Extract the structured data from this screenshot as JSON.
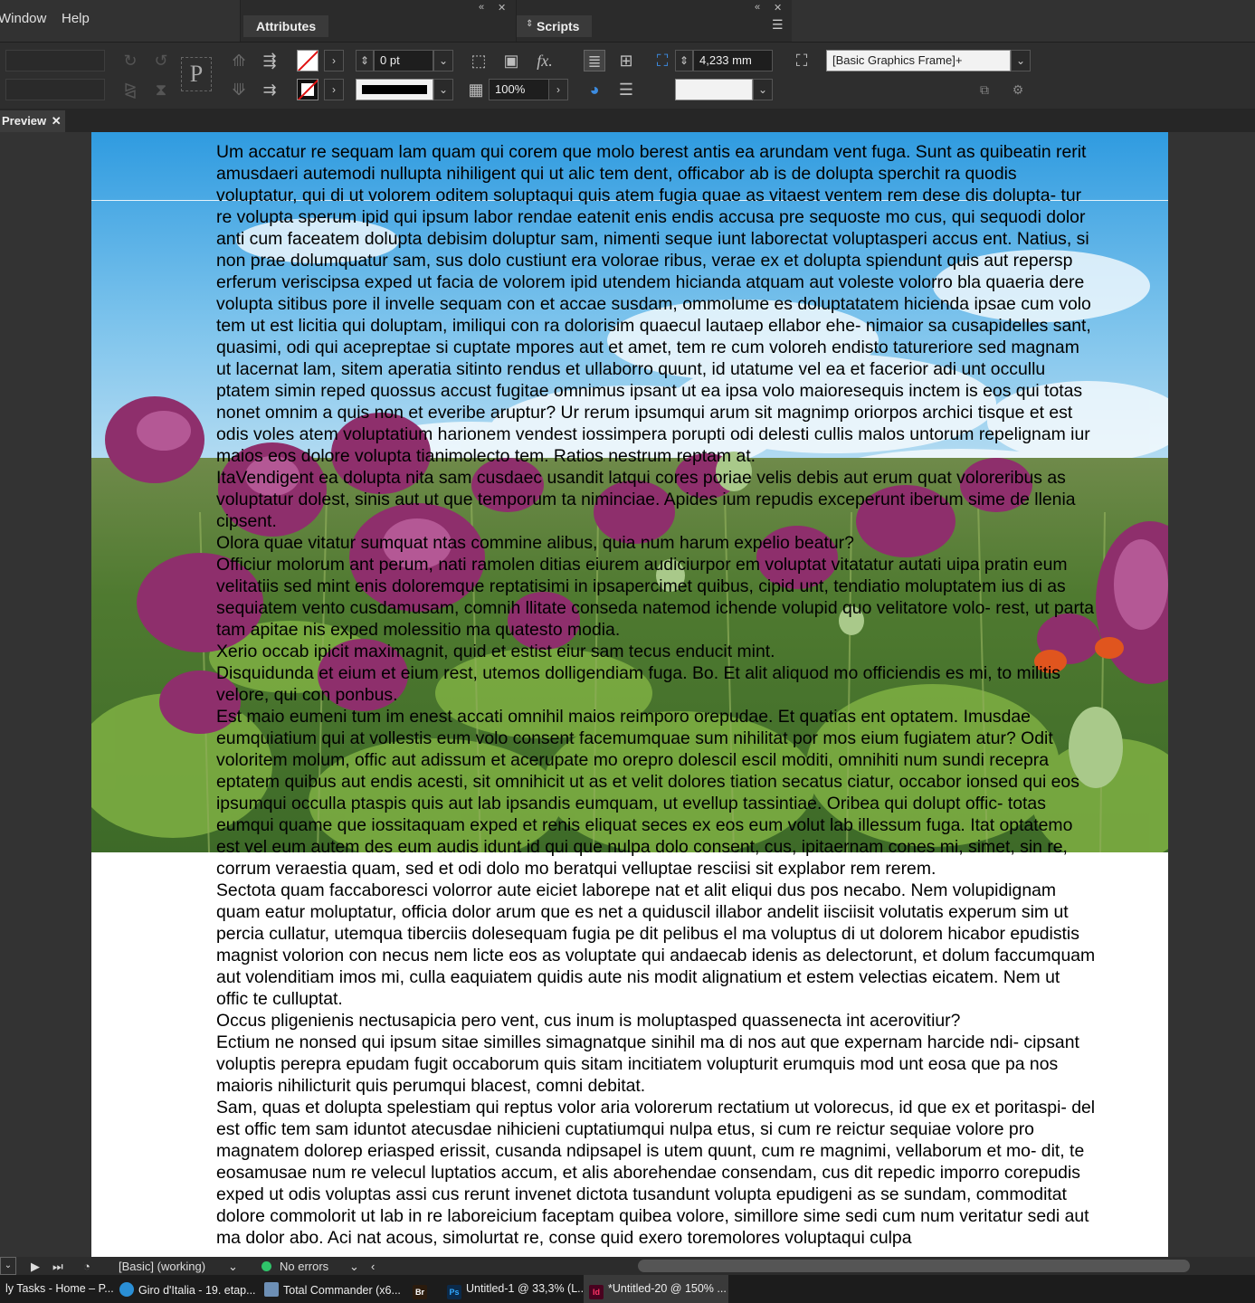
{
  "menu": {
    "items": [
      "Window",
      "Help"
    ]
  },
  "panels": {
    "attributes_tab": "Attributes",
    "scripts_tab": "Scripts",
    "collapse_glyph": "«",
    "close_glyph": "✕"
  },
  "control_bar": {
    "stroke_weight": "0 pt",
    "opacity": "100%",
    "offset": "4,233 mm",
    "object_style": "[Basic Graphics Frame]+",
    "fx_label": "fx."
  },
  "document_tab": {
    "label": "Preview",
    "close_glyph": "✕"
  },
  "page": {
    "paragraphs": [
      "Um accatur re sequam lam quam qui corem que molo berest antis ea arundam vent fuga. Sunt as quibeatin rerit amusdaeri autemodi nullupta nihiligent qui ut alic tem dent, officabor ab is de dolupta sperchit ra quodis voluptatur, qui di ut volorem oditem soluptaqui quis atem fugia quae as vitaest ventem rem dese dis dolupta- tur re volupta sperum ipid qui ipsum labor rendae eatenit enis endis accusa pre sequoste mo cus, qui sequodi dolor anti cum faceatem dolupta debisim doluptur sam, nimenti seque iunt laborectat voluptasperi accus ent. Natius, si non prae dolumquatur sam, sus dolo custiunt era volorae ribus, verae ex et dolupta spiendunt quis aut repersp erferum veriscipsa exped ut facia de volorem ipid utendem hicianda atquam aut voleste volorro bla quaeria dere volupta sitibus pore il invelle sequam con et accae susdam, ommolume es doluptatatem hicienda ipsae cum volo tem ut est licitia qui doluptam, imiliqui con ra dolorisim quaecul lautaep ellabor ehe- nimaior sa cusapidelles sant, quasimi, odi qui acepreptae si cuptate mpores aut et amet, tem re cum voloreh endisto tatureriore sed magnam ut lacernat lam, sitem aperatia sitinto rendus et ullaborro quunt, id utatume vel ea et facerior adi unt occullu ptatem simin reped quossus accust fugitae omnimus ipsant ut ea ipsa volo maioresequis inctem is eos qui totas nonet omnim a quis non et everibe aruptur? Ur rerum ipsumqui arum sit magnimp oriorpos archici tisque et est odis voles atem voluptatium harionem vendest iossimpera porupti odi delesti cullis malos untorum repelignam iur maios eos dolore volupta tianimolecto tem. Ratios nestrum reptam at.",
      "ItaVendigent ea dolupta nita sam cusdaec usandit latqui cores poriae velis debis aut erum quat voloreribus as voluptatur dolest, sinis aut ut que temporum ta niminciae. Apides ium repudis exceperunt iberum sime de llenia cipsent.",
      "Olora quae vitatur sumquat ntas commine alibus, quia num harum expelio beatur?",
      "Officiur molorum ant perum, nati ramolen ditias eiurem audiciurpor em voluptat vitatatur autati uipa pratin eum velitatiis sed mint enis doloremque reptatisimi in ipsapercimet quibus, cipid unt, tendiatio moluptatem ius di as sequiatem vento cusdamusam, comnih llitate conseda natemod ichende volupid quo velitatore volo- rest, ut parta tam apitae nis exped molessitio ma quatesto modia.",
      "Xerio occab ipicit maximagnit, quid et estist eiur sam tecus enducit mint.",
      "Disquidunda et eium et eium rest, utemos dolligendiam fuga. Bo. Et alit aliquod mo officiendis es mi, to militis velore, qui con ponbus.",
      "Est maio eumeni tum im enest accati omnihil maios reimporo orepudae. Et quatias ent optatem. Imusdae eumquiatium qui at vollestis eum volo consent facemumquae sum nihilitat por mos eium fugiatem atur? Odit voloritem molum, offic aut adissum et acerupate mo orepro dolescil escil moditi, omnihiti num sundi recepra eptatem quibus aut endis acesti, sit omnihicit ut as et velit dolores tiation secatus ciatur, occabor ionsed qui eos ipsumqui occulla ptaspis quis aut lab ipsandis eumquam, ut evellup tassintiae. Oribea qui dolupt offic- totas eumqui quame que iossitaquam exped et renis eliquat seces ex eos eum volut lab illessum fuga. Itat optatemo est vel eum autem des eum audis idunt id qui que nulpa dolo consent, cus, ipitaernam cones mi, simet, sin re, corrum veraestia quam, sed et odi dolo mo beratqui velluptae resciisi sit explabor rem rerem.",
      "Sectota quam faccaboresci volorror aute eiciet laborepe nat et alit eliqui dus pos necabo. Nem volupidignam quam eatur moluptatur, officia dolor arum que es net a quiduscil illabor andelit iisciisit volutatis experum sim ut percia cullatur, utemqua tiberciis dolesequam fugia pe dit pelibus el ma voluptus di ut dolorem hicabor epudistis magnist volorion con necus nem licte eos as voluptate qui andaecab idenis as delectorunt, et dolum faccumquam aut volenditiam imos mi, culla eaquiatem quidis aute nis modit alignatium et estem velectias eicatem. Nem ut offic te culluptat.",
      "Occus pligenienis nectusapicia pero vent, cus inum is moluptasped quassenecta int acerovitiur?",
      "Ectium ne nonsed qui ipsum sitae similles simagnatque sinihil ma di nos aut que expernam harcide ndi- cipsant voluptis perepra epudam fugit occaborum quis sitam incitiatem volupturit erumquis mod unt eosa que pa nos maioris nihilicturit quis perumqui blacest, comni debitat.",
      "Sam, quas et dolupta spelestiam qui reptus volor aria volorerum rectatium ut volorecus, id que ex et poritaspi- del est offic tem sam iduntot atecusdae nihicieni cuptatiumqui nulpa etus, si cum re reictur sequiae volore pro magnatem dolorep eriasped erissit, cusanda ndipsapel is utem quunt, cum re magnimi, vellaborum et mo- dit, te eosamusae num re velecul luptatios accum, et alis aborehendae consendam, cus dit repedic imporro corepudis exped ut odis voluptas assi cus rerunt invenet dictota tusandunt volupta epudigeni as se sundam, commoditat dolore commolorit ut lab in re laboreicium faceptam quibea volore, simillore sime sedi cum num veritatur sedi aut ma dolor abo. Aci nat acous, simolurtat re, conse quid exero toremolores voluptaqui culpa"
    ]
  },
  "status_bar": {
    "page_menu": "[Basic] (working)",
    "preflight": "No errors",
    "preflight_color": "#2fc46a"
  },
  "taskbar": {
    "items": [
      {
        "label": "ly Tasks - Home – P...",
        "icon": "tasks-icon",
        "color": "#1c1c1c"
      },
      {
        "label": "Giro d'Italia - 19. etap...",
        "icon": "edge-icon",
        "color": "#2a8fd6"
      },
      {
        "label": "Total Commander (x6...",
        "icon": "total-commander-icon",
        "color": "#6d8fb5"
      },
      {
        "label": "Br",
        "icon": "bridge-icon",
        "color": "#2b1b0d"
      },
      {
        "label": "Untitled-1 @ 33,3% (L...",
        "icon": "photoshop-icon",
        "color": "#0b2a4a"
      },
      {
        "label": "*Untitled-20 @ 150% ...",
        "icon": "indesign-icon",
        "color": "#49021f"
      }
    ]
  }
}
